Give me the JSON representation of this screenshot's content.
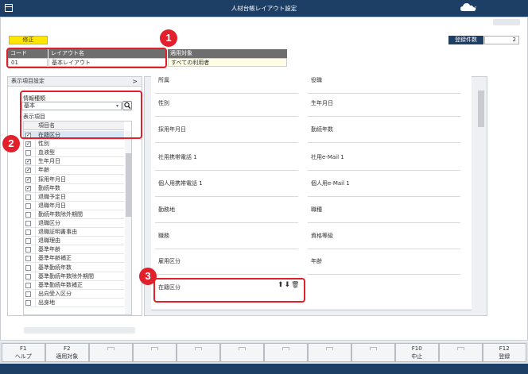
{
  "window": {
    "title": "人材台帳レイアウト設定",
    "logo_text": "Ai"
  },
  "header": {
    "mode_badge": "修正",
    "count_label": "登録件数",
    "count_value": "2"
  },
  "layout_table": {
    "headers": [
      "コード",
      "レイアウト名",
      "適用対象"
    ],
    "row": [
      "01",
      "基本レイアウト",
      "すべての利用者"
    ]
  },
  "left_panel": {
    "title": "表示項目設定",
    "chevron": ">",
    "info_type_label": "情報種類",
    "info_type_value": "基本",
    "display_items_label": "表示項目",
    "column_header": "項目名",
    "items": [
      {
        "label": "在籍区分",
        "checked": true,
        "selected": true
      },
      {
        "label": "性別",
        "checked": true
      },
      {
        "label": "血液型",
        "checked": false
      },
      {
        "label": "生年月日",
        "checked": true
      },
      {
        "label": "年齢",
        "checked": true
      },
      {
        "label": "採用年月日",
        "checked": true
      },
      {
        "label": "勤続年数",
        "checked": true
      },
      {
        "label": "退職予定日",
        "checked": false
      },
      {
        "label": "退職年月日",
        "checked": false
      },
      {
        "label": "勤続年数除外期間",
        "checked": false
      },
      {
        "label": "退職区分",
        "checked": false
      },
      {
        "label": "退職証明書事由",
        "checked": false
      },
      {
        "label": "退職理由",
        "checked": false
      },
      {
        "label": "基準年齢",
        "checked": false
      },
      {
        "label": "基準年齢補正",
        "checked": false
      },
      {
        "label": "基準勤続年数",
        "checked": false
      },
      {
        "label": "基準勤続年数除外期間",
        "checked": false
      },
      {
        "label": "基準勤続年数補正",
        "checked": false
      },
      {
        "label": "出向受入区分",
        "checked": false
      },
      {
        "label": "出身地",
        "checked": false
      }
    ]
  },
  "layout_fields": {
    "left": [
      "所属",
      "性別",
      "採用年月日",
      "社用携帯電話 1",
      "個人用携帯電話 1",
      "勤務地",
      "職務",
      "雇用区分",
      "在籍区分"
    ],
    "right": [
      "役職",
      "生年月日",
      "勤続年数",
      "社用e-Mail 1",
      "個人用e-Mail 1",
      "職種",
      "資格等級",
      "年齢"
    ]
  },
  "callouts": [
    "1",
    "2",
    "3"
  ],
  "function_keys": [
    {
      "key": "F1",
      "label": "ヘルプ",
      "enabled": true
    },
    {
      "key": "F2",
      "label": "適用対象",
      "enabled": true
    },
    {
      "key": "",
      "label": "",
      "enabled": false
    },
    {
      "key": "",
      "label": "",
      "enabled": false
    },
    {
      "key": "",
      "label": "",
      "enabled": false
    },
    {
      "key": "",
      "label": "",
      "enabled": false
    },
    {
      "key": "",
      "label": "",
      "enabled": false
    },
    {
      "key": "",
      "label": "",
      "enabled": false
    },
    {
      "key": "",
      "label": "",
      "enabled": false
    },
    {
      "key": "F10",
      "label": "中止",
      "enabled": true
    },
    {
      "key": "",
      "label": "",
      "enabled": false
    },
    {
      "key": "F12",
      "label": "登録",
      "enabled": true
    }
  ]
}
